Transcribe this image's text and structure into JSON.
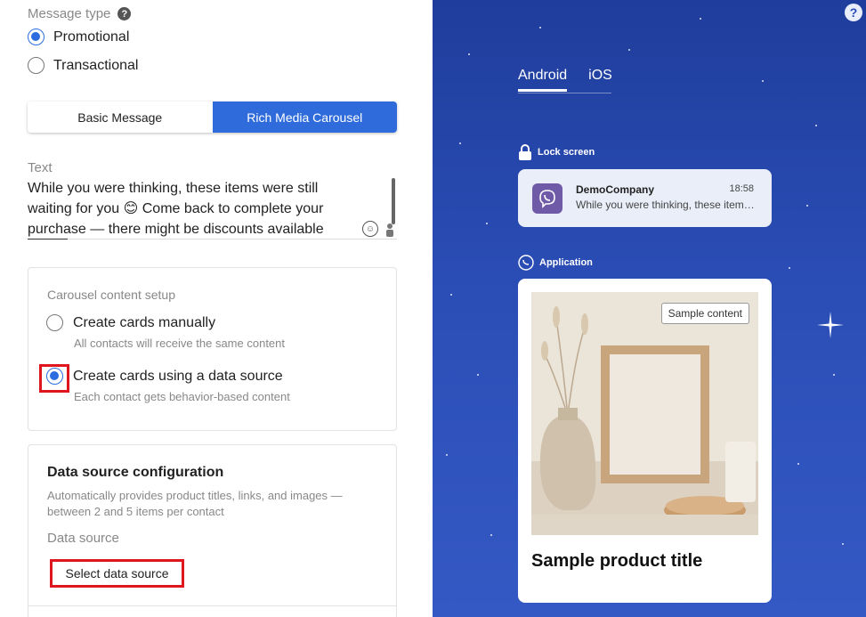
{
  "message_type": {
    "label": "Message type",
    "options": [
      {
        "label": "Promotional",
        "checked": true
      },
      {
        "label": "Transactional",
        "checked": false
      }
    ]
  },
  "tabs": {
    "basic": "Basic Message",
    "carousel": "Rich Media Carousel",
    "active": "carousel"
  },
  "text_field": {
    "label": "Text",
    "line1": "While you were thinking, these items were still",
    "line2_a": "waiting for you ",
    "emoji": "😊",
    "line2_b": " Come back to complete your",
    "line3": "purchase — there might be discounts available"
  },
  "carousel_setup": {
    "title": "Carousel content setup",
    "option_manual": "Create cards manually",
    "option_manual_sub": "All contacts will receive the same content",
    "option_data": "Create cards using a data source",
    "option_data_sub": "Each contact gets behavior-based content",
    "selected": "data"
  },
  "data_source": {
    "title": "Data source configuration",
    "desc": "Automatically provides product titles, links, and images — between 2 and 5 items per contact",
    "label": "Data source",
    "button": "Select data source"
  },
  "preview": {
    "tab_android": "Android",
    "tab_ios": "iOS",
    "lock_screen_label": "Lock screen",
    "notif_name": "DemoCompany",
    "notif_time": "18:58",
    "notif_text": "While you were thinking, these items were still waiting for you",
    "application_label": "Application",
    "sample_badge": "Sample content",
    "product_title": "Sample product title"
  },
  "colors": {
    "accent": "#2f6bdb",
    "highlight": "#e0161e",
    "viber": "#6f5aa7"
  }
}
